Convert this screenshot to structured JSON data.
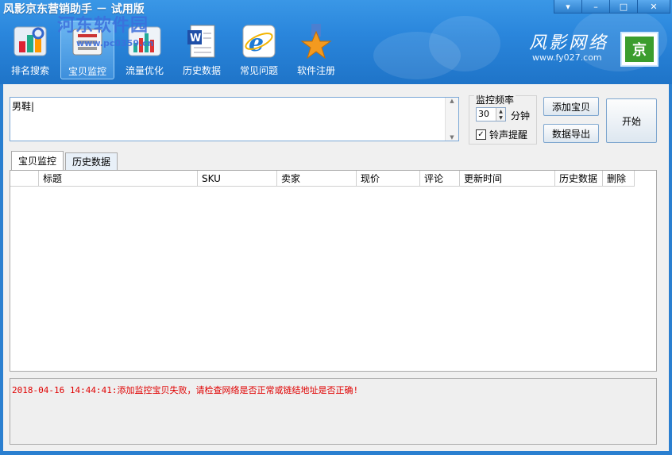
{
  "window": {
    "title": "风影京东营销助手 － 试用版",
    "controls": [
      "▾",
      "–",
      "□",
      "✕"
    ]
  },
  "watermark": {
    "line1": "河东软件园",
    "line2": "www.pc0359.cn"
  },
  "toolbar": {
    "items": [
      {
        "label": "排名搜索",
        "icon": "ranking-search-icon"
      },
      {
        "label": "宝贝监控",
        "icon": "monitor-icon",
        "active": true
      },
      {
        "label": "流量优化",
        "icon": "traffic-chart-icon"
      },
      {
        "label": "历史数据",
        "icon": "word-document-icon"
      },
      {
        "label": "常见问题",
        "icon": "ie-browser-icon"
      },
      {
        "label": "软件注册",
        "icon": "star-medal-icon"
      }
    ]
  },
  "brand": {
    "name": "风影网络",
    "url": "www.fy027.com",
    "logo_text": "京"
  },
  "keyword_box": {
    "value": "男鞋|"
  },
  "frequency": {
    "legend": "监控频率",
    "value": "30",
    "unit": "分钟",
    "bell_label": "铃声提醒",
    "bell_checked": true
  },
  "buttons": {
    "add": "添加宝贝",
    "export": "数据导出",
    "start": "开始"
  },
  "tabs": [
    {
      "label": "宝贝监控",
      "active": true
    },
    {
      "label": "历史数据",
      "active": false
    }
  ],
  "table": {
    "columns": [
      "",
      "标题",
      "SKU",
      "卖家",
      "现价",
      "评论",
      "更新时间",
      "历史数据",
      "删除"
    ],
    "rows": []
  },
  "log": {
    "lines": [
      "2018-04-16 14:44:41:添加监控宝贝失败，请检查网络是否正常或链结地址是否正确!"
    ]
  },
  "colors": {
    "title_bg": "#2a86dc",
    "log_error": "#e00000",
    "brand_logo": "#3b9d2e"
  }
}
